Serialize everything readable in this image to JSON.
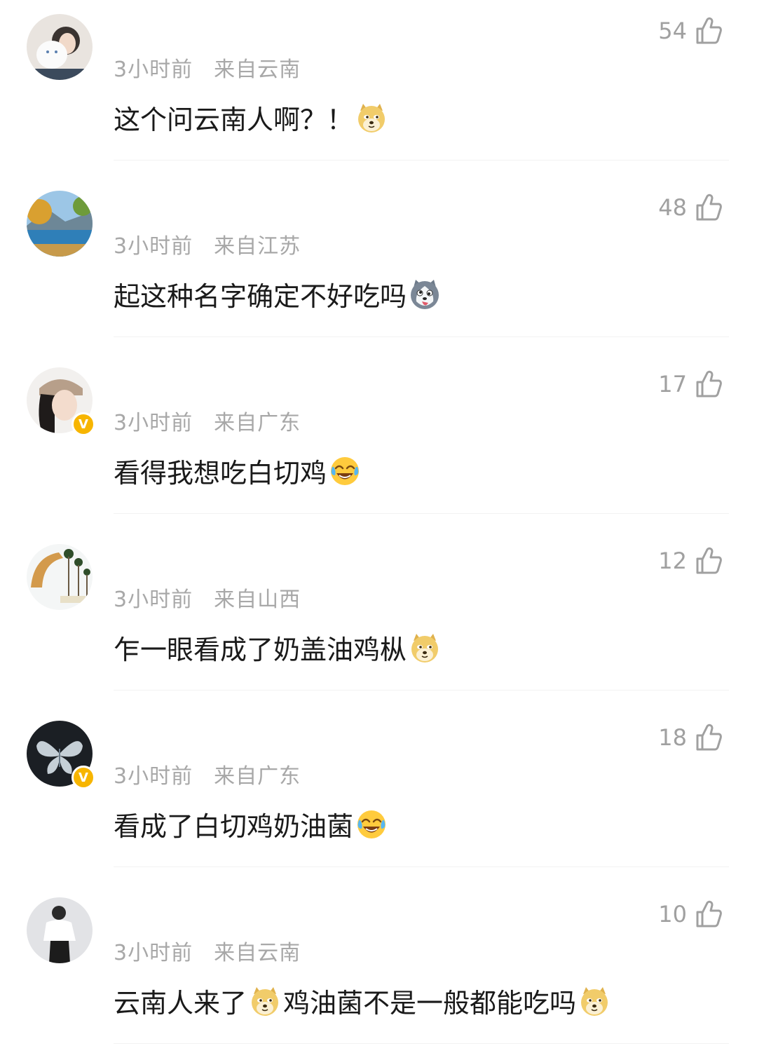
{
  "comments": [
    {
      "time": "3小时前",
      "location": "来自云南",
      "likes": "54",
      "verified": false,
      "segments": [
        "这个问云南人啊？！",
        "",
        ""
      ],
      "emojis": [
        "doge",
        "",
        ""
      ],
      "avatar": "girl-with-cat"
    },
    {
      "time": "3小时前",
      "location": "来自江苏",
      "likes": "48",
      "verified": false,
      "segments": [
        "起这种名字确定不好吃吗",
        "",
        ""
      ],
      "emojis": [
        "husky-tongue",
        "",
        ""
      ],
      "avatar": "lake-landscape"
    },
    {
      "time": "3小时前",
      "location": "来自广东",
      "likes": "17",
      "verified": true,
      "segments": [
        "看得我想吃白切鸡",
        "",
        ""
      ],
      "emojis": [
        "laugh-cry",
        "",
        ""
      ],
      "avatar": "girl-with-cap"
    },
    {
      "time": "3小时前",
      "location": "来自山西",
      "likes": "12",
      "verified": false,
      "segments": [
        "乍一眼看成了奶盖油鸡枞",
        "",
        ""
      ],
      "emojis": [
        "doge",
        "",
        ""
      ],
      "avatar": "giraffe-palms"
    },
    {
      "time": "3小时前",
      "location": "来自广东",
      "likes": "18",
      "verified": true,
      "segments": [
        "看成了白切鸡奶油菌",
        "",
        ""
      ],
      "emojis": [
        "laugh-cry",
        "",
        ""
      ],
      "avatar": "white-butterfly"
    },
    {
      "time": "3小时前",
      "location": "来自云南",
      "likes": "10",
      "verified": false,
      "segments": [
        "云南人来了",
        "鸡油菌不是一般都能吃吗",
        ""
      ],
      "emojis": [
        "doge",
        "doge",
        ""
      ],
      "avatar": "woman-white-shirt"
    }
  ],
  "colors": {
    "meta": "#a8a8a8",
    "text": "#1a1a1a",
    "badge": "#f7b500",
    "divider": "#f2f2f2"
  },
  "icons": {
    "like": "thumbs-up-outline-icon",
    "verified": "verified-v-badge-icon"
  }
}
